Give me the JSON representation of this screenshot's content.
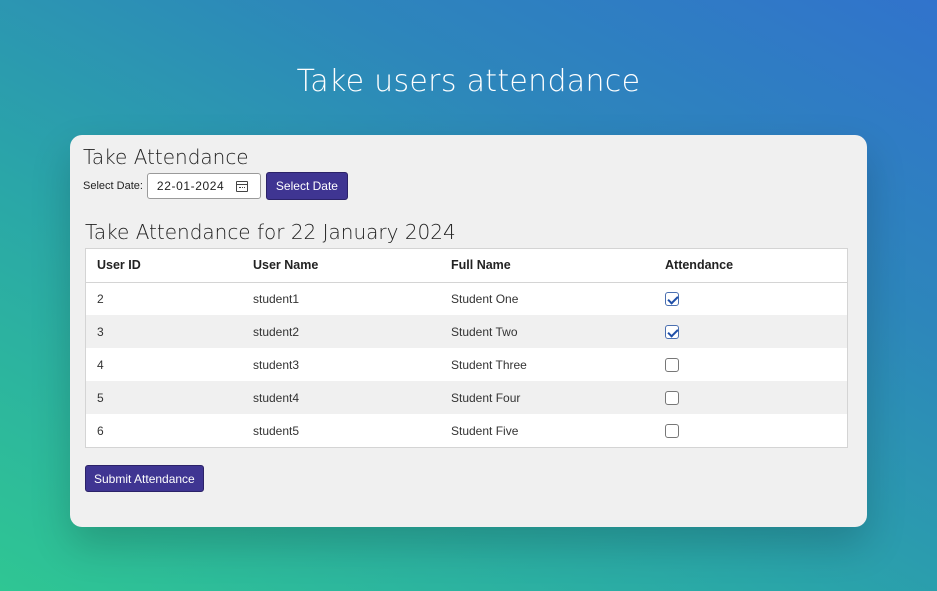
{
  "page": {
    "heading": "Take users attendance"
  },
  "card": {
    "title": "Take Attendance",
    "date_label": "Select Date:",
    "date_value": "22-01-2024",
    "select_date_label": "Select Date",
    "table_title": "Take Attendance for 22 January 2024",
    "submit_label": "Submit Attendance"
  },
  "table": {
    "headers": [
      "User ID",
      "User Name",
      "Full Name",
      "Attendance"
    ],
    "rows": [
      {
        "id": "2",
        "username": "student1",
        "fullname": "Student One",
        "present": true
      },
      {
        "id": "3",
        "username": "student2",
        "fullname": "Student Two",
        "present": true
      },
      {
        "id": "4",
        "username": "student3",
        "fullname": "Student Three",
        "present": false
      },
      {
        "id": "5",
        "username": "student4",
        "fullname": "Student Four",
        "present": false
      },
      {
        "id": "6",
        "username": "student5",
        "fullname": "Student Five",
        "present": false
      }
    ]
  },
  "colors": {
    "button": "#3f3592",
    "checkbox_check": "#1f4fa8"
  }
}
